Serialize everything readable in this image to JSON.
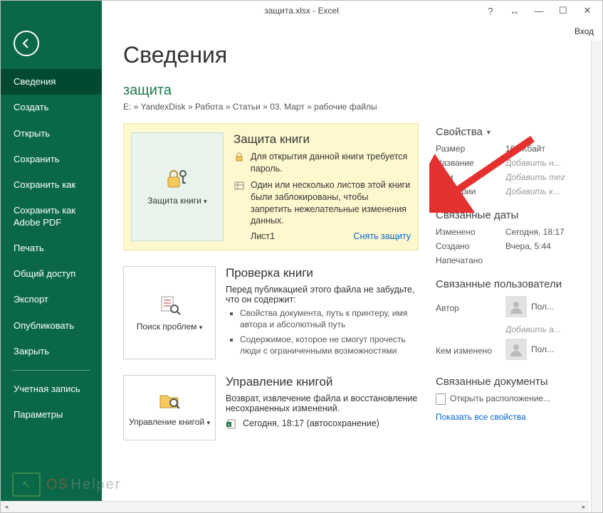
{
  "titlebar": {
    "title": "защита.xlsx - Excel",
    "login": "Вход"
  },
  "sidebar": {
    "items": [
      "Сведения",
      "Создать",
      "Открыть",
      "Сохранить",
      "Сохранить как",
      "Сохранить как Adobe PDF",
      "Печать",
      "Общий доступ",
      "Экспорт",
      "Опубликовать",
      "Закрыть"
    ],
    "footer": [
      "Учетная запись",
      "Параметры"
    ]
  },
  "page": {
    "heading": "Сведения",
    "filename": "защита",
    "breadcrumb": "E: » YandexDisk » Работа » Статьи » 03. Март » рабочие файлы"
  },
  "protect": {
    "button": "Защита книги",
    "title": "Защита книги",
    "line1": "Для открытия данной книги требуется пароль.",
    "line2": "Один или несколько листов этой книги были заблокированы, чтобы запретить нежелательные изменения данных.",
    "sheet": "Лист1",
    "unprotect": "Снять защиту"
  },
  "inspect": {
    "button": "Поиск проблем",
    "title": "Проверка книги",
    "intro": "Перед публикацией этого файла не забудьте, что он содержит:",
    "bullets": [
      "Свойства документа, путь к принтеру, имя автора и абсолютный путь",
      "Содержимое, которое не смогут прочесть люди с ограниченными возможностями"
    ]
  },
  "manage": {
    "button": "Управление книгой",
    "title": "Управление книгой",
    "intro": "Возврат, извлечение файла и восстановление несохраненных изменений.",
    "entry": "Сегодня, 18:17 (автосохранение)"
  },
  "properties": {
    "title": "Свойства",
    "rows": [
      {
        "k": "Размер",
        "v": "16,3Кбайт",
        "italic": false
      },
      {
        "k": "Название",
        "v": "Добавить н...",
        "italic": true
      },
      {
        "k": "Теги",
        "v": "Добавить тег",
        "italic": true
      },
      {
        "k": "Категории",
        "v": "Добавить к...",
        "italic": true
      }
    ]
  },
  "dates": {
    "title": "Связанные даты",
    "rows": [
      {
        "k": "Изменено",
        "v": "Сегодня, 18:17"
      },
      {
        "k": "Создано",
        "v": "Вчера, 5:44"
      },
      {
        "k": "Напечатано",
        "v": ""
      }
    ]
  },
  "people": {
    "title": "Связанные пользователи",
    "author_label": "Автор",
    "author_name": "Пол...",
    "add_author": "Добавить а...",
    "changed_label": "Кем изменено",
    "changed_name": "Пол..."
  },
  "docs": {
    "title": "Связанные документы",
    "open_location": "Открыть расположение...",
    "show_all": "Показать все свойства"
  },
  "watermark": {
    "os": "OS",
    "helper": "Helper"
  }
}
